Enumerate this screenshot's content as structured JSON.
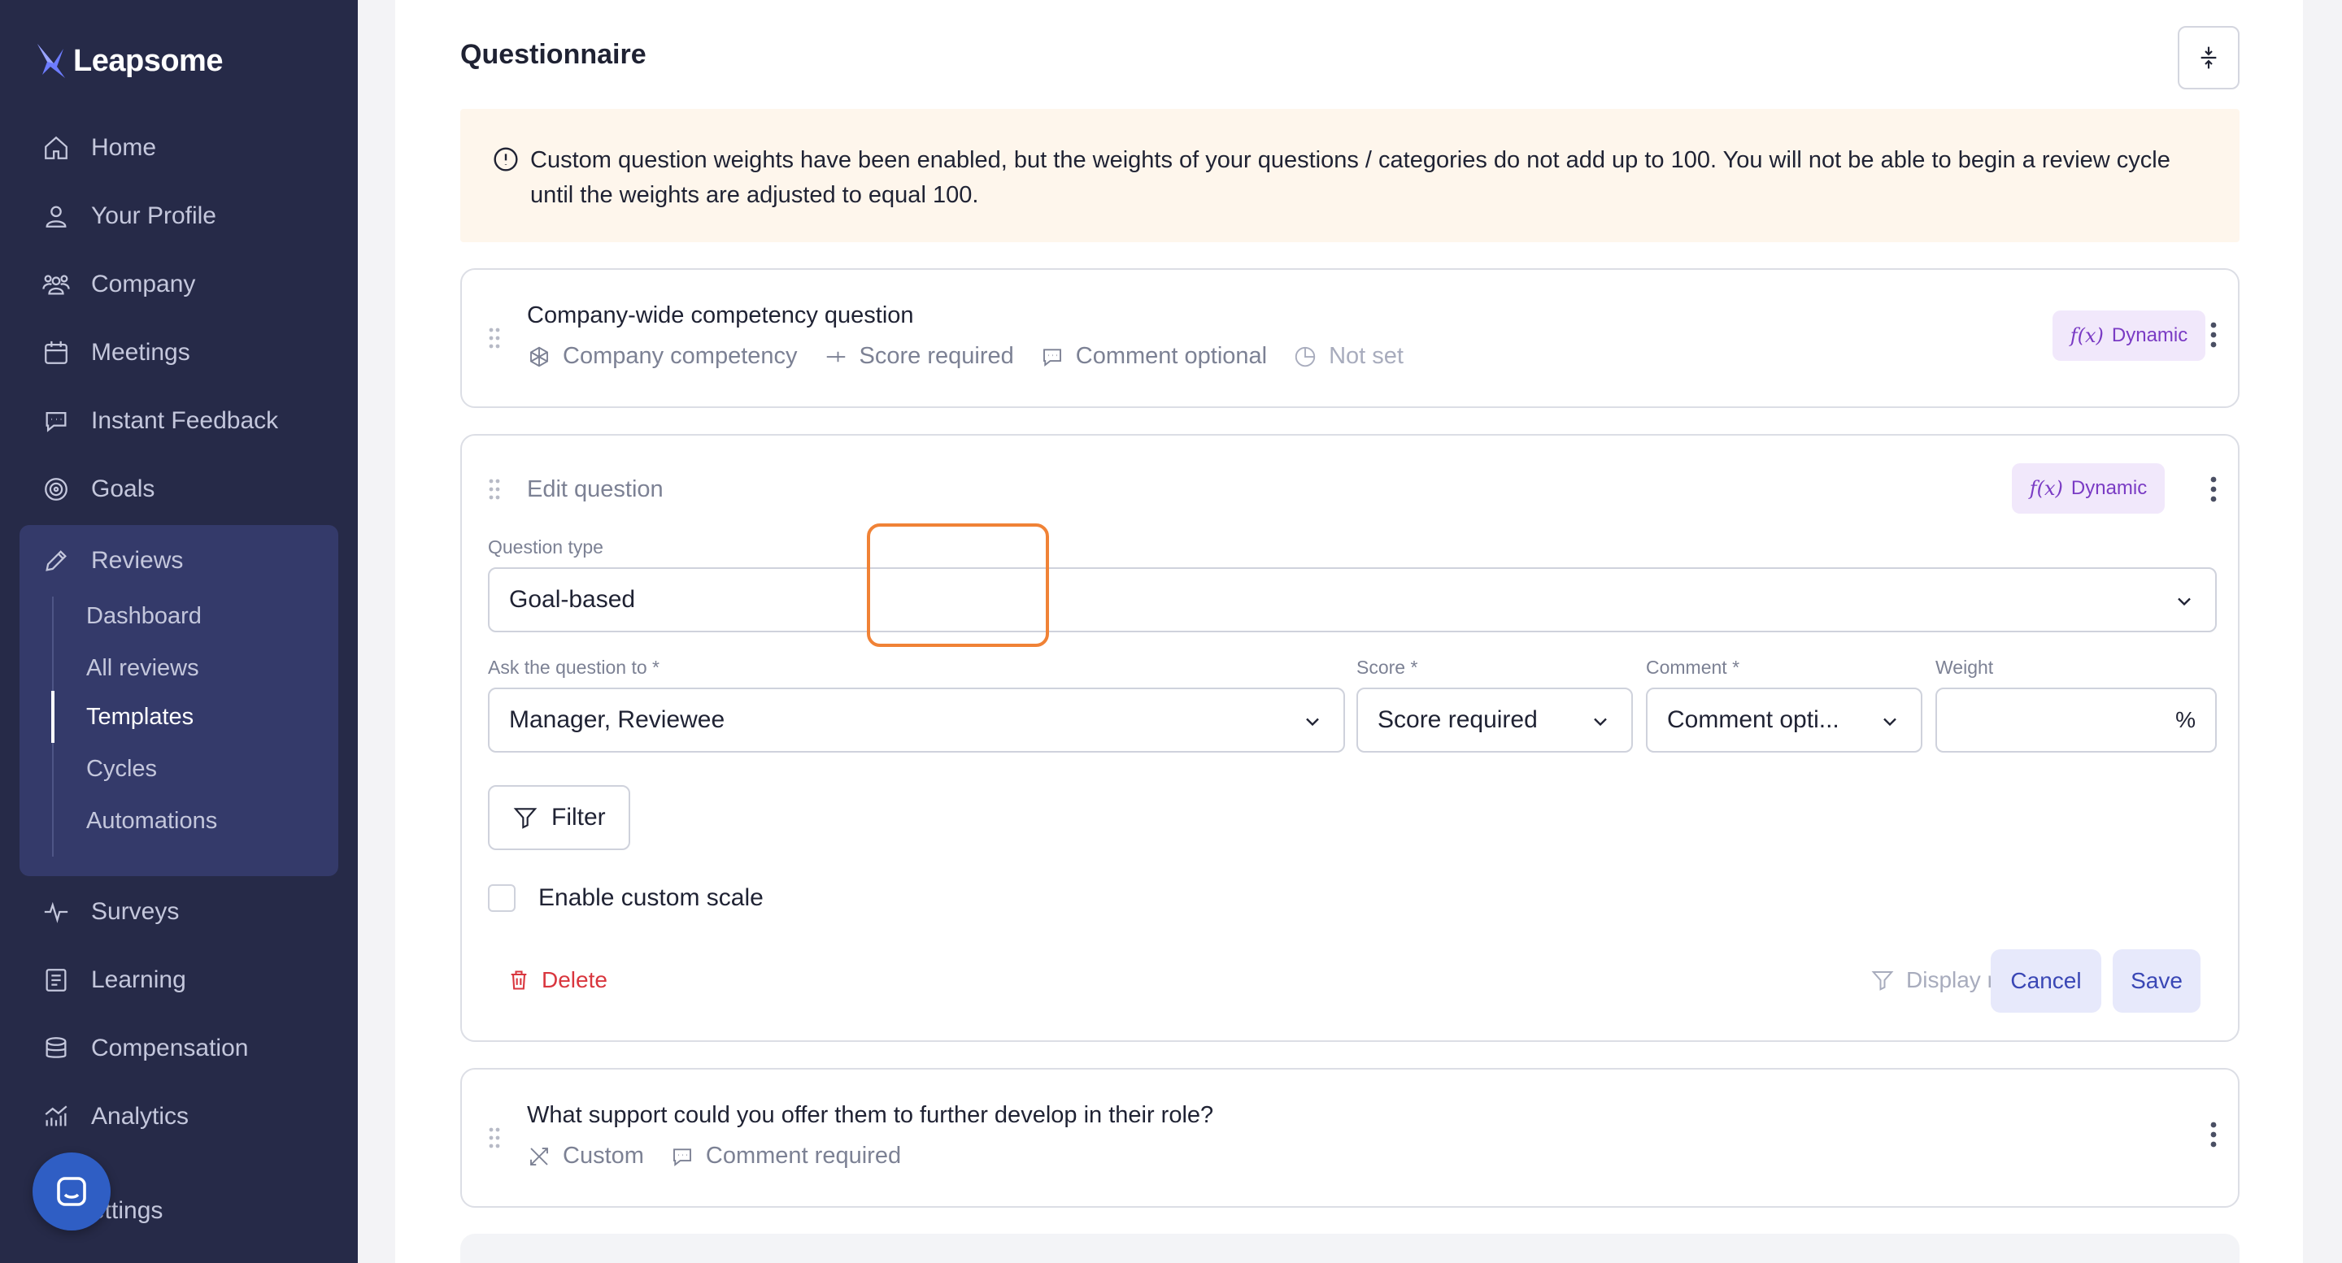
{
  "brand": {
    "name": "Leapsome"
  },
  "sidebar": {
    "items": [
      {
        "label": "Home",
        "icon": "home-icon"
      },
      {
        "label": "Your Profile",
        "icon": "user-icon"
      },
      {
        "label": "Company",
        "icon": "team-icon"
      },
      {
        "label": "Meetings",
        "icon": "calendar-icon"
      },
      {
        "label": "Instant Feedback",
        "icon": "chat-icon"
      },
      {
        "label": "Goals",
        "icon": "target-icon"
      }
    ],
    "reviews": {
      "label": "Reviews",
      "icon": "pencil-icon",
      "sub_items": [
        {
          "label": "Dashboard"
        },
        {
          "label": "All reviews"
        },
        {
          "label": "Templates",
          "active": true
        },
        {
          "label": "Cycles"
        },
        {
          "label": "Automations"
        }
      ]
    },
    "items_after": [
      {
        "label": "Surveys",
        "icon": "pulse-icon"
      },
      {
        "label": "Learning",
        "icon": "book-icon"
      },
      {
        "label": "Compensation",
        "icon": "coins-icon"
      },
      {
        "label": "Analytics",
        "icon": "analytics-icon"
      },
      {
        "label": "ettings",
        "icon": "settings-icon"
      }
    ]
  },
  "main": {
    "title": "Questionnaire",
    "warning": "Custom question weights have been enabled, but the weights of your questions / categories do not add up to 100. You will not be able to begin a review cycle until the weights are adjusted to equal 100.",
    "question1": {
      "title": "Company-wide competency question",
      "meta": [
        "Company competency",
        "Score required",
        "Comment optional",
        "Not set"
      ],
      "badge": "Dynamic",
      "badge_fx": "f(x)"
    },
    "edit": {
      "title": "Edit question",
      "badge": "Dynamic",
      "badge_fx": "f(x)",
      "question_type_label": "Question type",
      "question_type_value": "Goal-based",
      "ask_label": "Ask the question to *",
      "ask_value": "Manager, Reviewee",
      "score_label": "Score *",
      "score_value": "Score required",
      "comment_label": "Comment *",
      "comment_value": "Comment opti...",
      "weight_label": "Weight",
      "weight_value": "",
      "weight_unit": "%",
      "filter_label": "Filter",
      "custom_scale_label": "Enable custom scale",
      "delete_label": "Delete",
      "display_rules_label": "Display rules",
      "cancel_label": "Cancel",
      "save_label": "Save"
    },
    "question3": {
      "title": "What support could you offer them to further develop in their role?",
      "meta": [
        "Custom",
        "Comment required"
      ]
    }
  },
  "colors": {
    "sidebar_bg": "#262a48",
    "active_group_bg": "#343a6a",
    "warning_bg": "#fef6ec",
    "dynamic_badge_bg": "#f1e8fb",
    "highlight": "#f08236",
    "delete": "#d9363e",
    "primary_soft": "#e7e9fb"
  }
}
